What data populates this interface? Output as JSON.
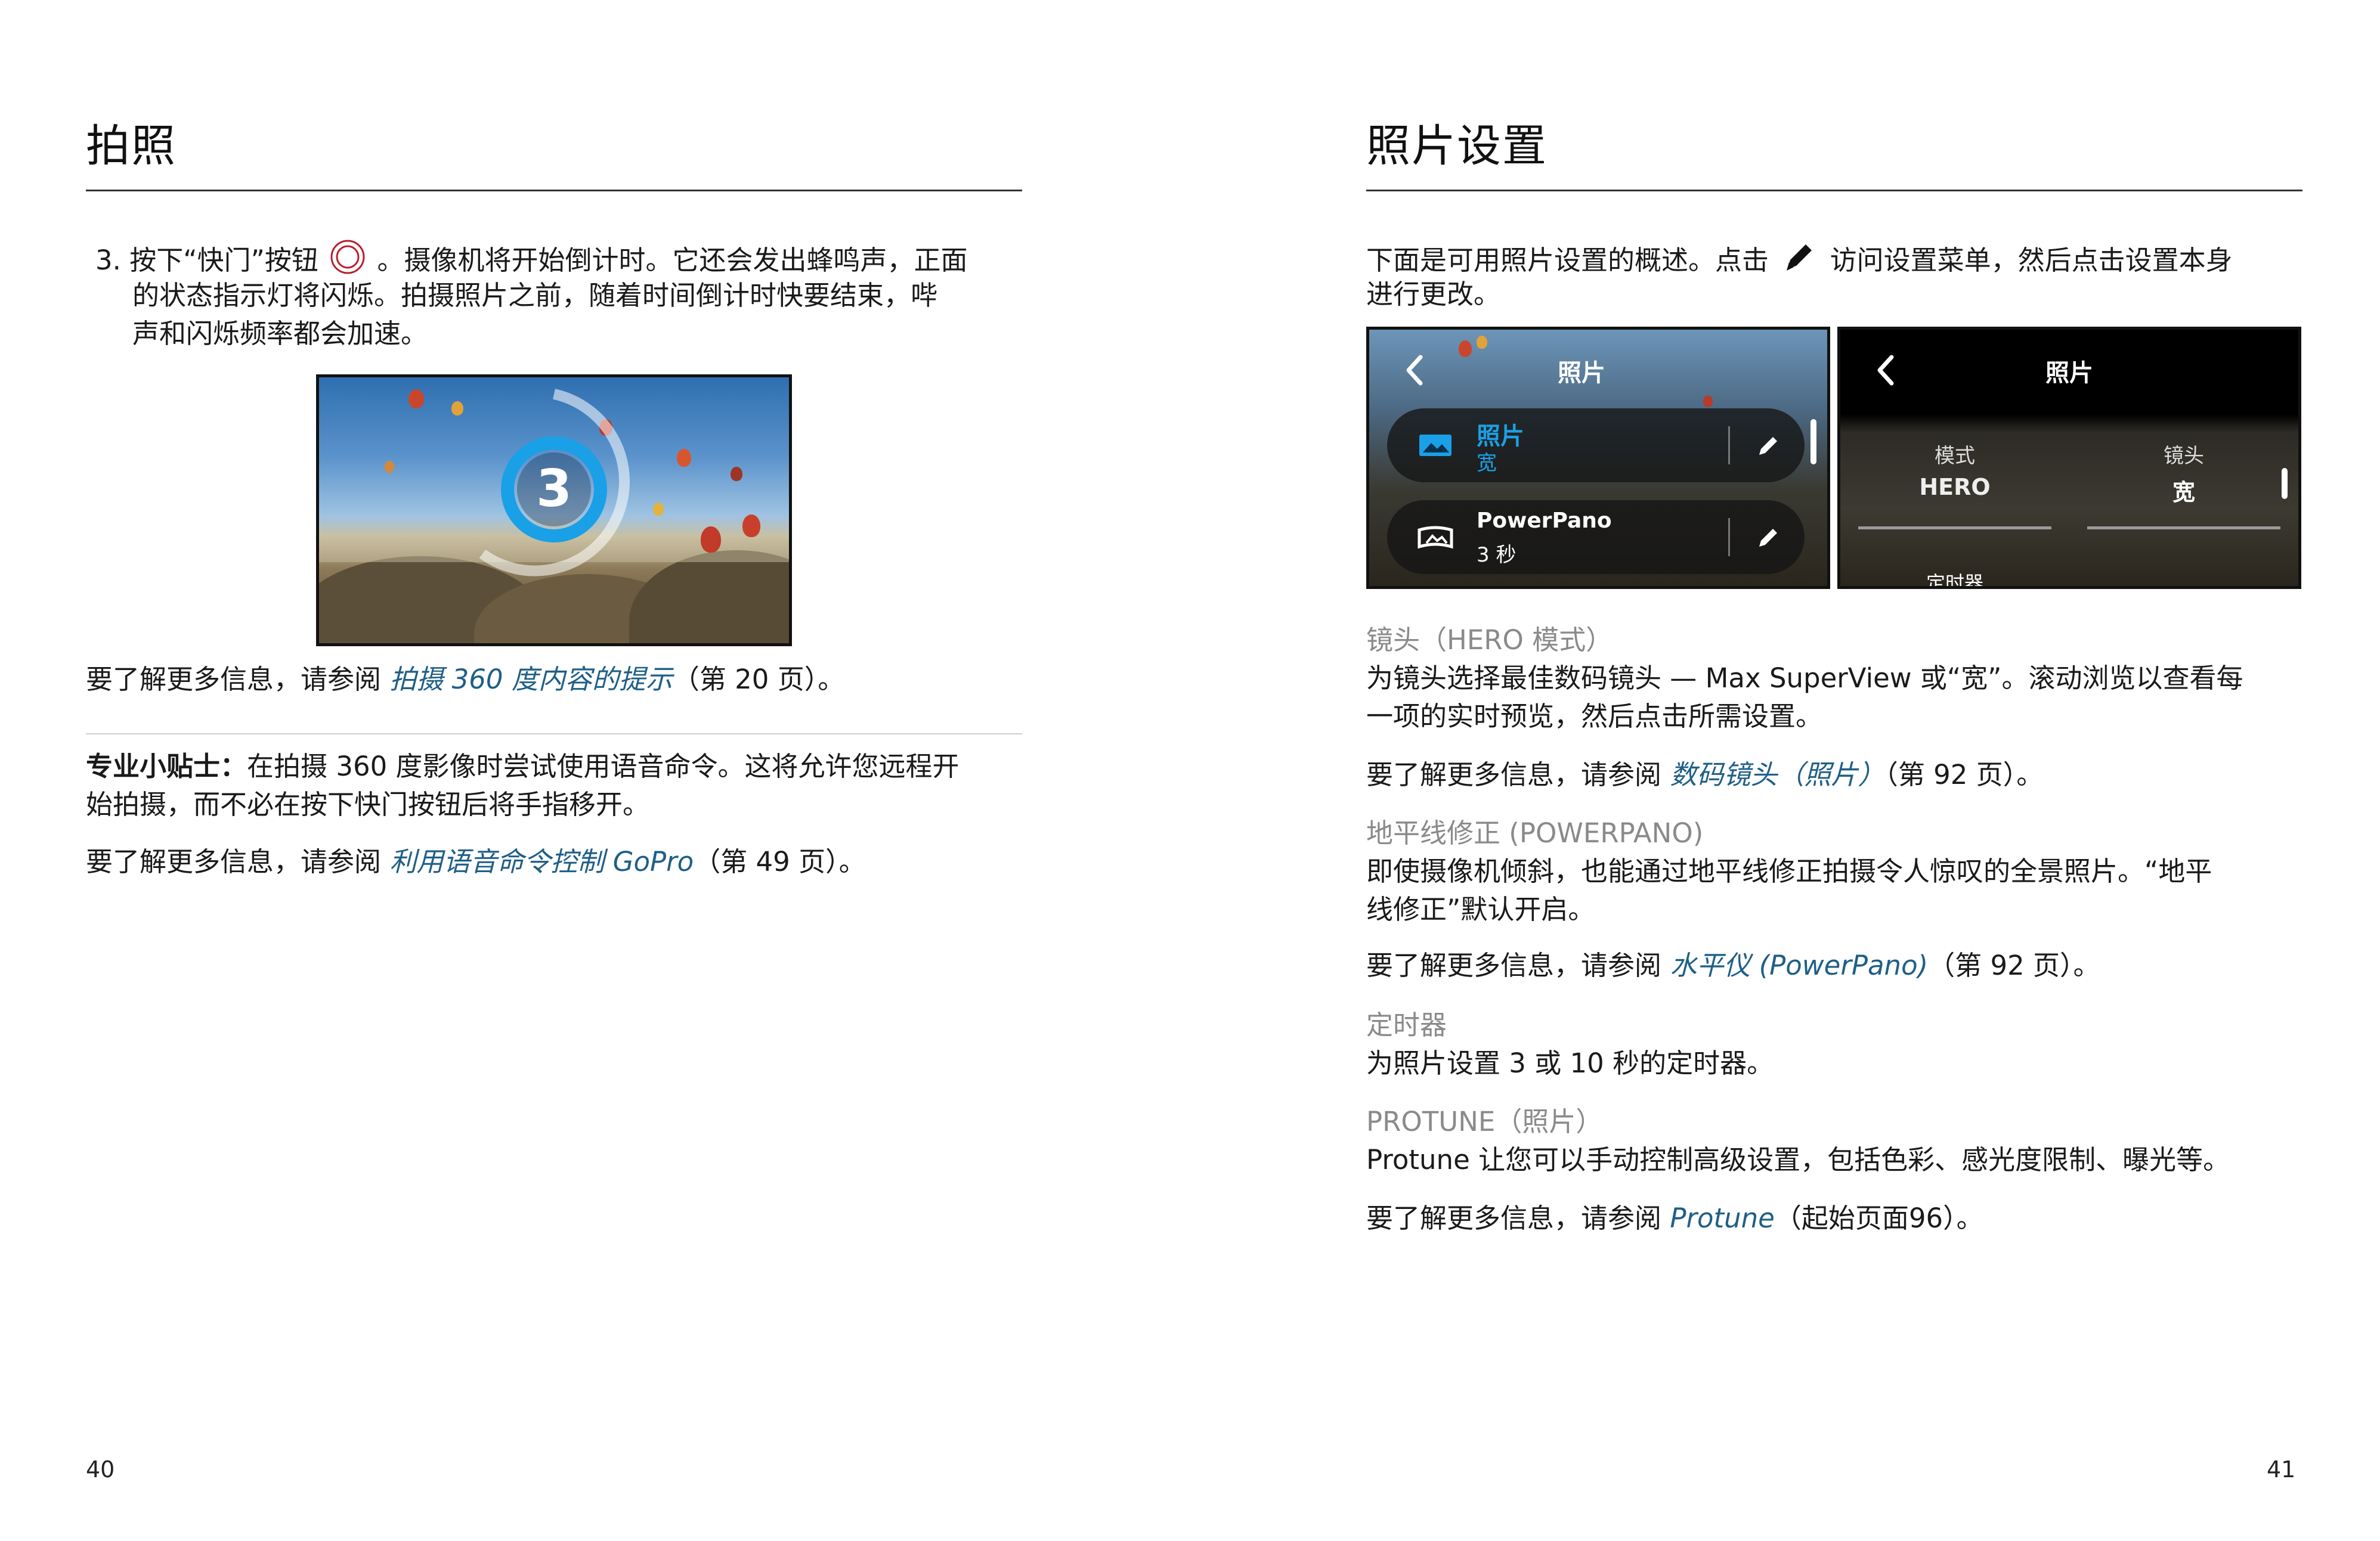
{
  "left": {
    "title": "拍照",
    "step": {
      "number": "3.",
      "line1a": "按下“快门”按钮",
      "line1b": "。摄像机将开始倒计时。它还会发出蜂鸣声，正面",
      "line2": "的状态指示灯将闪烁。拍摄照片之前，随着时间倒计时快要结束，哔",
      "line3": "声和闪烁频率都会加速。"
    },
    "countdown_number": "3",
    "more_info_1": {
      "prefix": "要了解更多信息，请参阅 ",
      "link": "拍摄 360 度内容的提示",
      "suffix": "（第 20 页）。"
    },
    "tip": {
      "label": "专业小贴士：",
      "line1": "在拍摄 360 度影像时尝试使用语音命令。这将允许您远程开",
      "line2": "始拍摄，而不必在按下快门按钮后将手指移开。"
    },
    "more_info_2": {
      "prefix": "要了解更多信息，请参阅 ",
      "link": "利用语音命令控制 GoPro",
      "suffix": "（第 49 页）。"
    },
    "page_number": "40"
  },
  "right": {
    "title": "照片设置",
    "intro": {
      "line1a": "下面是可用照片设置的概述。点击",
      "line1b": "访问设置菜单，然后点击设置本身",
      "line2": "进行更改。"
    },
    "panel1": {
      "title": "照片",
      "item1": {
        "label": "照片",
        "value": "宽"
      },
      "item2": {
        "label": "PowerPano",
        "value": "3 秒"
      }
    },
    "panel2": {
      "title": "照片",
      "col1": {
        "label": "模式",
        "value": "HERO"
      },
      "col2": {
        "label": "镜头",
        "value": "宽"
      },
      "cut_label": "定时器"
    },
    "lens": {
      "heading": "镜头（HERO 模式）",
      "line1": "为镜头选择最佳数码镜头 — Max SuperView 或“宽”。滚动浏览以查看每",
      "line2": "一项的实时预览，然后点击所需设置。",
      "more_prefix": "要了解更多信息，请参阅 ",
      "more_link": "数码镜头（照片）",
      "more_suffix": "（第 92 页）。"
    },
    "horizon": {
      "heading": "地平线修正 (POWERPANO)",
      "line1": "即使摄像机倾斜，也能通过地平线修正拍摄令人惊叹的全景照片。“地平",
      "line2": "线修正”默认开启。",
      "more_prefix": "要了解更多信息，请参阅 ",
      "more_link": "水平仪 (PowerPano)",
      "more_suffix": "（第 92 页）。"
    },
    "timer": {
      "heading": "定时器",
      "line1": "为照片设置 3 或 10 秒的定时器。"
    },
    "protune": {
      "heading": "PROTUNE（照片）",
      "line1": "Protune 让您可以手动控制高级设置，包括色彩、感光度限制、曝光等。",
      "more_prefix": "要了解更多信息，请参阅 ",
      "more_link": "Protune",
      "more_suffix": "（起始页面96）。"
    },
    "page_number": "41"
  },
  "colors": {
    "link": "#1f5f86",
    "subheading": "#8a8a8a",
    "countdown_blue": "#1aa0e6"
  },
  "icons": [
    "shutter-button-icon",
    "pencil-icon",
    "back-chevron-icon",
    "landscape-photo-icon",
    "panorama-icon",
    "edit-icon"
  ]
}
